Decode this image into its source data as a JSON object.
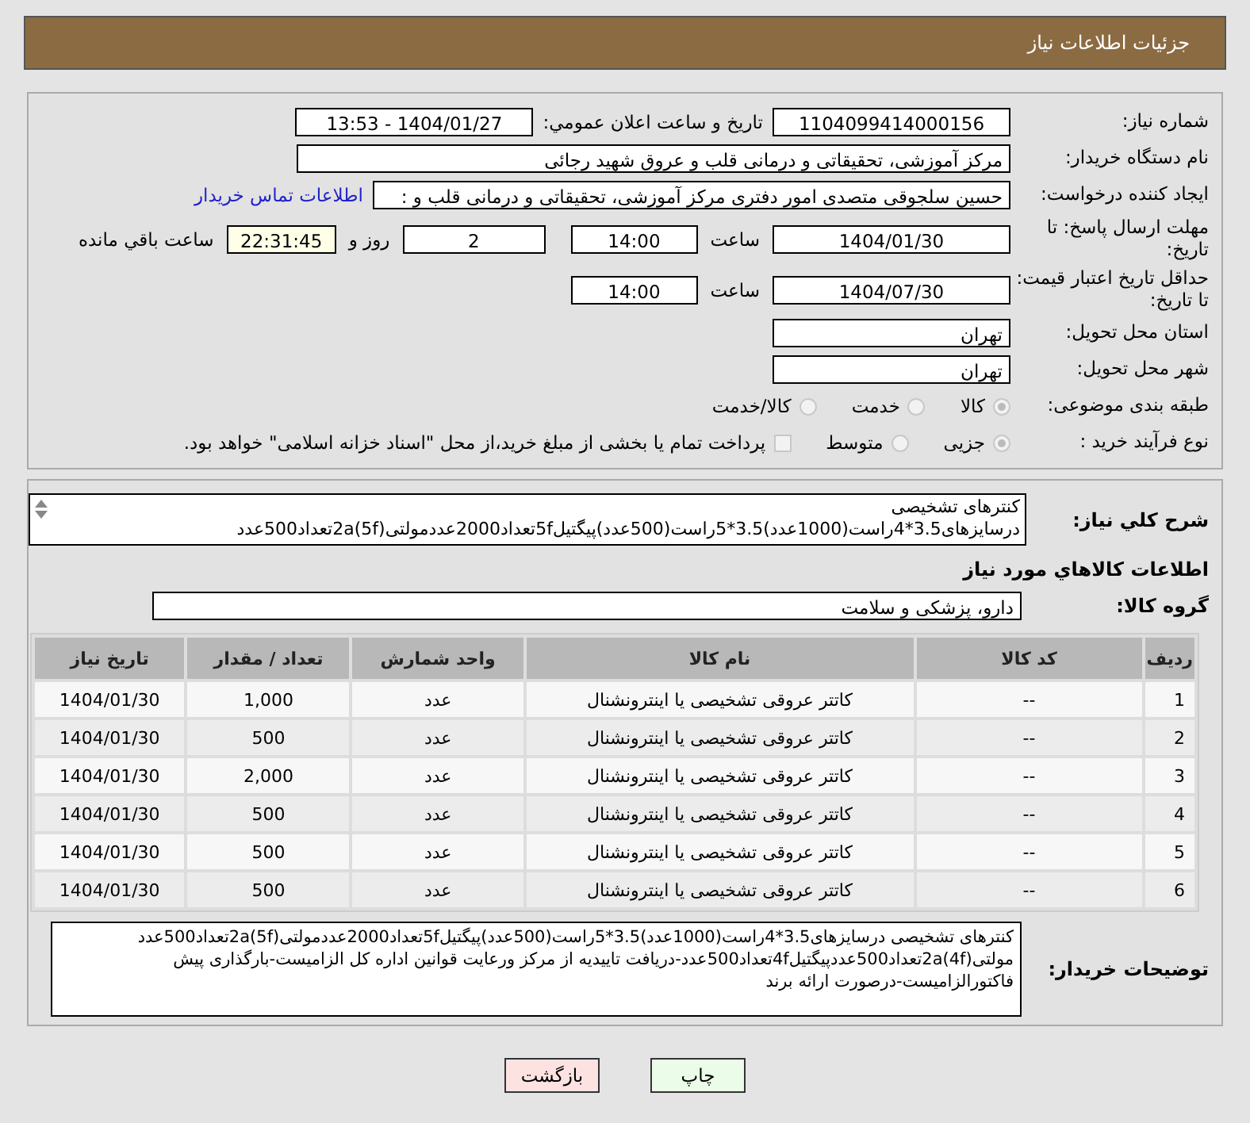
{
  "header": {
    "title": "جزئیات اطلاعات نیاز"
  },
  "fields": {
    "need_number": {
      "label": "شماره نیاز:",
      "value": "1104099414000156"
    },
    "announce": {
      "label": "تاریخ و ساعت اعلان عمومي:",
      "value": "1404/01/27 - 13:53"
    },
    "buyer_org": {
      "label": "نام دستگاه خریدار:",
      "value": "مرکز آموزشی، تحقیقاتی و درمانی قلب و عروق شهید رجائی"
    },
    "creator": {
      "label": "ایجاد کننده درخواست:",
      "value": "حسین سلجوقی متصدی امور دفتری مرکز آموزشی، تحقیقاتی و درمانی قلب و :",
      "link": "اطلاعات تماس خریدار"
    },
    "deadline": {
      "label": "مهلت ارسال پاسخ: تا تاریخ:",
      "date": "1404/01/30",
      "time_label": "ساعت",
      "time": "14:00",
      "days": "2",
      "days_label": "روز و",
      "remaining": "22:31:45",
      "remaining_label": "ساعت باقي مانده"
    },
    "validity": {
      "label": "حداقل تاریخ اعتبار قیمت: تا تاریخ:",
      "date": "1404/07/30",
      "time_label": "ساعت",
      "time": "14:00"
    },
    "province": {
      "label": "استان محل تحویل:",
      "value": "تهران"
    },
    "city": {
      "label": "شهر محل تحویل:",
      "value": "تهران"
    }
  },
  "category": {
    "label": "طبقه بندی موضوعی:",
    "options": [
      {
        "label": "کالا",
        "selected": true
      },
      {
        "label": "خدمت",
        "selected": false
      },
      {
        "label": "کالا/خدمت",
        "selected": false
      }
    ]
  },
  "process": {
    "label": "نوع فرآیند خرید :",
    "options": [
      {
        "label": "جزیی",
        "selected": true
      },
      {
        "label": "متوسط",
        "selected": false
      }
    ],
    "treasury": {
      "label": "پرداخت تمام یا بخشی از مبلغ خرید،از محل \"اسناد خزانه اسلامی\" خواهد بود.",
      "checked": false
    }
  },
  "description": {
    "label": "شرح کلي نياز:",
    "lines": [
      "کنترهای تشخیصی",
      "درسایزهای3.5*4راست(1000عدد)3.5*5راست(500عدد)پیگتیل5fتعداد2000عددمولتی2a(5f)تعداد500عدد"
    ]
  },
  "goods_title": "اطلاعات کالاهاي مورد نياز",
  "goods_group": {
    "label": "گروه کالا:",
    "value": "دارو، پزشکی و سلامت"
  },
  "table": {
    "columns": [
      "ردیف",
      "کد کالا",
      "نام کالا",
      "واحد شمارش",
      "تعداد / مقدار",
      "تاریخ نیاز"
    ],
    "rows": [
      [
        "1",
        "--",
        "کاتتر عروقی تشخیصی یا اینترونشنال",
        "عدد",
        "1,000",
        "1404/01/30"
      ],
      [
        "2",
        "--",
        "کاتتر عروقی تشخیصی یا اینترونشنال",
        "عدد",
        "500",
        "1404/01/30"
      ],
      [
        "3",
        "--",
        "کاتتر عروقی تشخیصی یا اینترونشنال",
        "عدد",
        "2,000",
        "1404/01/30"
      ],
      [
        "4",
        "--",
        "کاتتر عروقی تشخیصی یا اینترونشنال",
        "عدد",
        "500",
        "1404/01/30"
      ],
      [
        "5",
        "--",
        "کاتتر عروقی تشخیصی یا اینترونشنال",
        "عدد",
        "500",
        "1404/01/30"
      ],
      [
        "6",
        "--",
        "کاتتر عروقی تشخیصی یا اینترونشنال",
        "عدد",
        "500",
        "1404/01/30"
      ]
    ]
  },
  "notes": {
    "label": "توضیحات خریدار:",
    "lines": [
      "کنترهای تشخیصی درسایزهای3.5*4راست(1000عدد)3.5*5راست(500عدد)پیگتیل5fتعداد2000عددمولتی2a(5f)تعداد500عدد",
      "مولتی2a(4f)تعداد500عددپیگتیل4fتعداد500عدد-دریافت تاییدیه از مرکز ورعایت قوانین اداره کل الزامیست-بارگذاری پیش",
      "فاکتورالزامیست-درصورت ارائه برند"
    ]
  },
  "buttons": [
    {
      "label": "چاپ",
      "kind": "print"
    },
    {
      "label": "بازگشت",
      "kind": "back"
    }
  ]
}
